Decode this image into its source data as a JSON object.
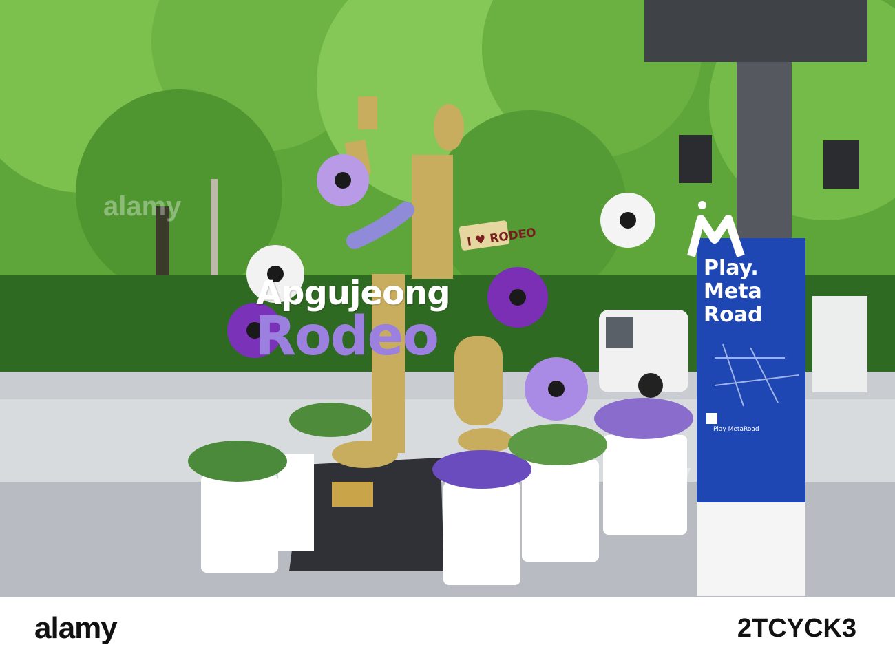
{
  "photo": {
    "sign": {
      "line1": "Apgujeong",
      "line2": "Rodeo"
    },
    "statue_plate": "I ♥ RODEO",
    "meta_sign": {
      "line1": "Play.",
      "line2": "Meta",
      "line3": "Road",
      "footer": "Play MetaRoad"
    }
  },
  "footer": {
    "brand": "alamy",
    "image_id": "2TCYCK3"
  },
  "watermark": {
    "text": "alamy"
  },
  "colors": {
    "sky_green": "#6fb04a",
    "sign_blue": "#1f47b4",
    "sign_purple": "#9c80e0"
  }
}
